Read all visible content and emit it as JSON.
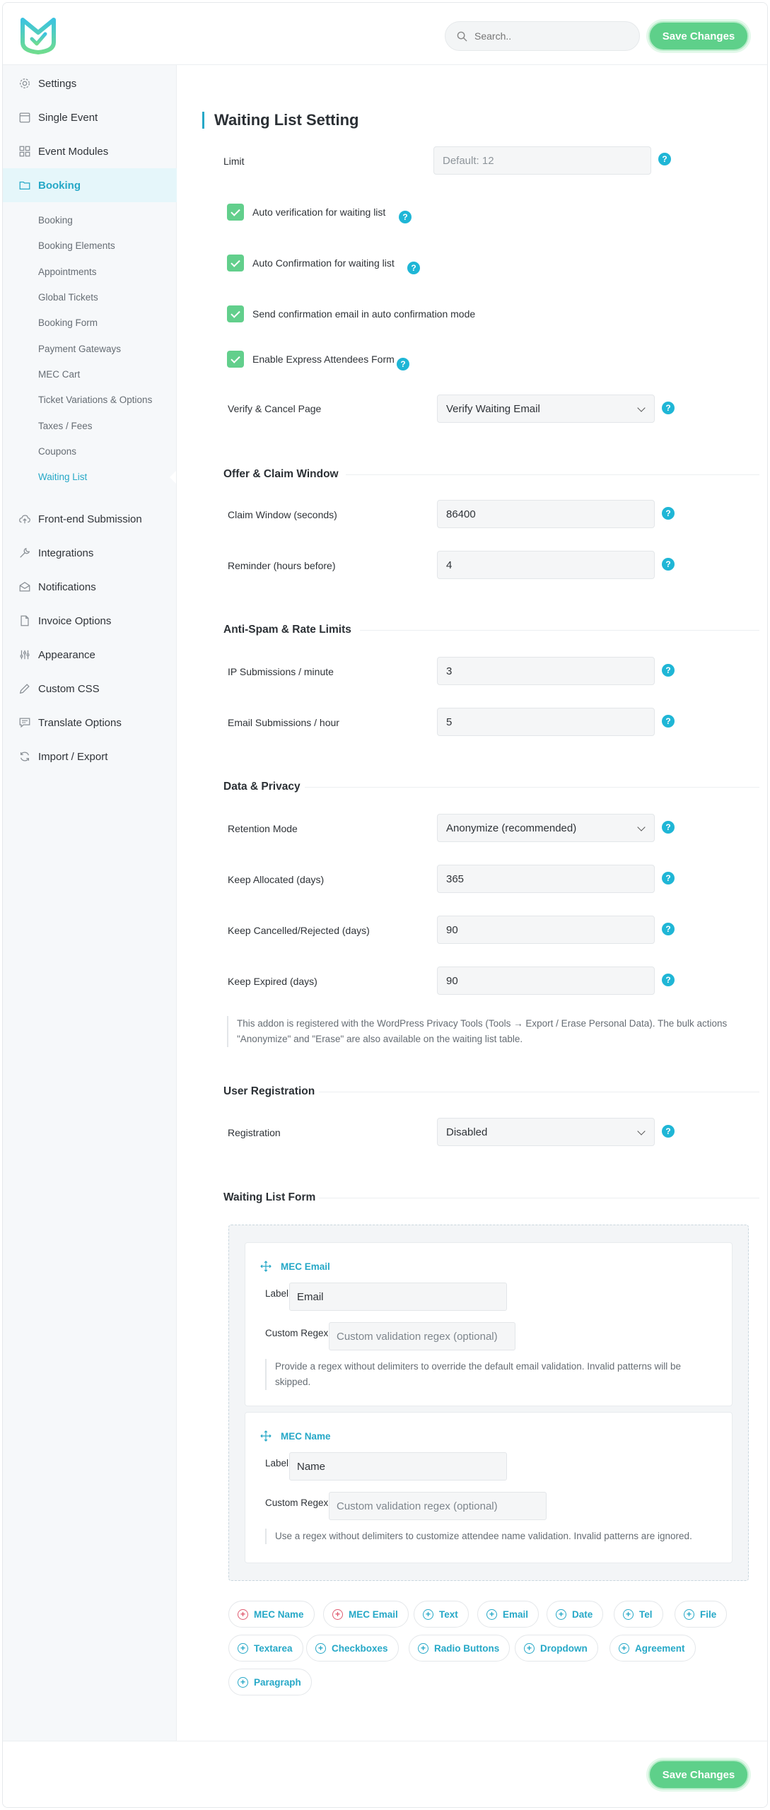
{
  "search": {
    "placeholder": "Search.."
  },
  "save_label": "Save Changes",
  "sidebar": {
    "items": [
      {
        "label": "Settings",
        "icon": "gear-icon"
      },
      {
        "label": "Single Event",
        "icon": "calendar-icon"
      },
      {
        "label": "Event Modules",
        "icon": "modules-icon"
      },
      {
        "label": "Booking",
        "icon": "folder-icon"
      },
      {
        "label": "Front-end Submission",
        "icon": "cloud-upload-icon"
      },
      {
        "label": "Integrations",
        "icon": "wrench-icon"
      },
      {
        "label": "Notifications",
        "icon": "envelope-icon"
      },
      {
        "label": "Invoice Options",
        "icon": "document-icon"
      },
      {
        "label": "Appearance",
        "icon": "sliders-icon"
      },
      {
        "label": "Custom CSS",
        "icon": "pencil-icon"
      },
      {
        "label": "Translate Options",
        "icon": "chat-icon"
      },
      {
        "label": "Import / Export",
        "icon": "refresh-icon"
      }
    ],
    "booking_sub": [
      "Booking",
      "Booking Elements",
      "Appointments",
      "Global Tickets",
      "Booking Form",
      "Payment Gateways",
      "MEC Cart",
      "Ticket Variations & Options",
      "Taxes / Fees",
      "Coupons",
      "Waiting List"
    ]
  },
  "main": {
    "title": "Waiting List Setting",
    "limit": {
      "label": "Limit",
      "placeholder": "Default: 12"
    },
    "checks": [
      "Auto verification for waiting list",
      "Auto Confirmation for waiting list",
      "Send confirmation email in auto confirmation mode",
      "Enable Express Attendees Form"
    ],
    "verify": {
      "label": "Verify & Cancel Page",
      "value": "Verify Waiting Email"
    },
    "offer": {
      "title": "Offer & Claim Window",
      "claim": {
        "label": "Claim Window (seconds)",
        "value": "86400"
      },
      "reminder": {
        "label": "Reminder (hours before)",
        "value": "4"
      }
    },
    "spam": {
      "title": "Anti-Spam & Rate Limits",
      "ip": {
        "label": "IP Submissions / minute",
        "value": "3"
      },
      "email": {
        "label": "Email Submissions / hour",
        "value": "5"
      }
    },
    "privacy": {
      "title": "Data & Privacy",
      "retention": {
        "label": "Retention Mode",
        "value": "Anonymize (recommended)"
      },
      "allocated": {
        "label": "Keep Allocated (days)",
        "value": "365"
      },
      "cancelled": {
        "label": "Keep Cancelled/Rejected (days)",
        "value": "90"
      },
      "expired": {
        "label": "Keep Expired (days)",
        "value": "90"
      },
      "note": "This addon is registered with the WordPress Privacy Tools (Tools → Export / Erase Personal Data). The bulk actions \"Anonymize\" and \"Erase\" are also available on the waiting list table."
    },
    "registration": {
      "title": "User Registration",
      "label": "Registration",
      "value": "Disabled"
    },
    "form": {
      "title": "Waiting List Form",
      "cards": [
        {
          "head": "MEC Email",
          "label_caption": "Label",
          "label_value": "Email",
          "regex_caption": "Custom Regex",
          "regex_placeholder": "Custom validation regex (optional)",
          "note": "Provide a regex without delimiters to override the default email validation. Invalid patterns will be skipped."
        },
        {
          "head": "MEC Name",
          "label_caption": "Label",
          "label_value": "Name",
          "regex_caption": "Custom Regex",
          "regex_placeholder": "Custom validation regex (optional)",
          "note": "Use a regex without delimiters to customize attendee name validation. Invalid patterns are ignored."
        }
      ],
      "chips": [
        {
          "label": "MEC Name",
          "used": true
        },
        {
          "label": "MEC Email",
          "used": true
        },
        {
          "label": "Text",
          "used": false
        },
        {
          "label": "Email",
          "used": false
        },
        {
          "label": "Date",
          "used": false
        },
        {
          "label": "Tel",
          "used": false
        },
        {
          "label": "File",
          "used": false
        },
        {
          "label": "Textarea",
          "used": false
        },
        {
          "label": "Checkboxes",
          "used": false
        },
        {
          "label": "Radio Buttons",
          "used": false
        },
        {
          "label": "Dropdown",
          "used": false
        },
        {
          "label": "Agreement",
          "used": false
        },
        {
          "label": "Paragraph",
          "used": false
        }
      ]
    }
  }
}
